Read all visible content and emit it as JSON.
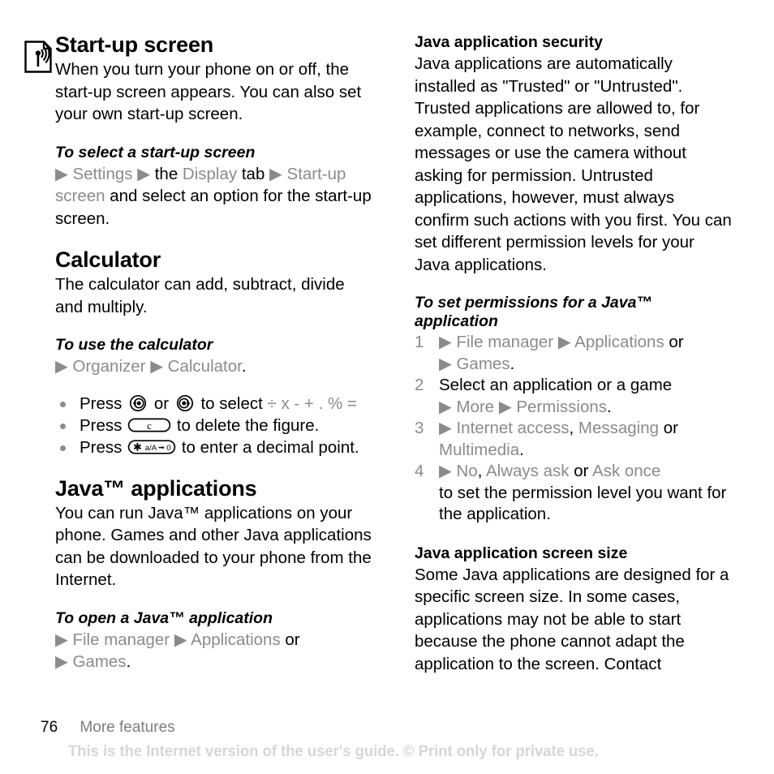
{
  "page": {
    "number": "76",
    "chapter": "More features",
    "disclaimer": "This is the Internet version of the user's guide. © Print only for private use."
  },
  "colors": {
    "text": "#000000",
    "ui_menu": "#8b8b8b",
    "disclaimer": "#d6d6d6",
    "chapter": "#7d7d7d"
  },
  "icons": {
    "margin": "broadcast-document-icon",
    "nav_left_key": "navigation-key-left",
    "nav_right_key": "navigation-key-right",
    "clear_key": "clear-key-c",
    "star_key": "star-key-a-A-0"
  },
  "left_column": {
    "startup": {
      "title": "Start-up screen",
      "body": "When you turn your phone on or off, the start-up screen appears. You can also set your own start-up screen.",
      "procedure": {
        "title": "To select a start-up screen",
        "parts": [
          {
            "type": "arrow",
            "text": "▶"
          },
          {
            "type": "ui",
            "text": "Settings"
          },
          {
            "type": "arrow",
            "text": "▶"
          },
          {
            "type": "text",
            "text": "the"
          },
          {
            "type": "ui",
            "text": "Display"
          },
          {
            "type": "text",
            "text": "tab"
          },
          {
            "type": "arrow",
            "text": "▶"
          },
          {
            "type": "ui",
            "text": "Start-up screen"
          },
          {
            "type": "text",
            "text": "and select an option for the start-up screen."
          }
        ]
      }
    },
    "calculator": {
      "title": "Calculator",
      "body": "The calculator can add, subtract, divide and multiply.",
      "procedure": {
        "title": "To use the calculator",
        "parts": [
          {
            "type": "arrow",
            "text": "▶"
          },
          {
            "type": "ui",
            "text": "Organizer"
          },
          {
            "type": "arrow",
            "text": "▶"
          },
          {
            "type": "ui",
            "text": "Calculator"
          },
          {
            "type": "text",
            "text": "."
          }
        ]
      },
      "bullets": [
        {
          "lead": "Press",
          "keys": [
            "navigation-key-left",
            "navigation-key-right"
          ],
          "between": "or",
          "tail": "to select",
          "symbols": "÷ x - + . % ="
        },
        {
          "lead": "Press",
          "keys": [
            "clear-key-c"
          ],
          "tail": "to delete the figure."
        },
        {
          "lead": "Press",
          "keys": [
            "star-key-a-A-0"
          ],
          "tail": "to enter a decimal point."
        }
      ]
    },
    "java_apps": {
      "title": "Java™ applications",
      "body": "You can run Java™ applications on your phone. Games and other Java applications can be downloaded to your phone from the Internet.",
      "procedure": {
        "title": "To open a Java™ application",
        "parts": [
          {
            "type": "arrow",
            "text": "▶"
          },
          {
            "type": "ui",
            "text": "File manager"
          },
          {
            "type": "arrow",
            "text": "▶"
          },
          {
            "type": "ui",
            "text": "Applications"
          },
          {
            "type": "text",
            "text": "or"
          },
          {
            "type": "break",
            "text": ""
          },
          {
            "type": "arrow",
            "text": "▶"
          },
          {
            "type": "ui",
            "text": "Games"
          },
          {
            "type": "text",
            "text": "."
          }
        ]
      }
    }
  },
  "right_column": {
    "security": {
      "title": "Java application security",
      "body": "Java applications are automatically installed as \"Trusted\" or \"Untrusted\". Trusted applications are allowed to, for example, connect to networks, send messages or use the camera without asking for permission. Untrusted applications, however, must always confirm such actions with you first. You can set different permission levels for your Java applications.",
      "procedure_title": "To set permissions for a Java™ application",
      "steps": [
        {
          "number": "1",
          "parts": [
            {
              "type": "arrow",
              "text": "▶"
            },
            {
              "type": "ui",
              "text": "File manager"
            },
            {
              "type": "arrow",
              "text": "▶"
            },
            {
              "type": "ui",
              "text": "Applications"
            },
            {
              "type": "text",
              "text": "or"
            },
            {
              "type": "break",
              "text": ""
            },
            {
              "type": "arrow",
              "text": "▶"
            },
            {
              "type": "ui",
              "text": "Games"
            },
            {
              "type": "text",
              "text": "."
            }
          ]
        },
        {
          "number": "2",
          "parts": [
            {
              "type": "text",
              "text": "Select an application or a game"
            },
            {
              "type": "break",
              "text": ""
            },
            {
              "type": "arrow",
              "text": "▶"
            },
            {
              "type": "ui",
              "text": "More"
            },
            {
              "type": "arrow",
              "text": "▶"
            },
            {
              "type": "ui",
              "text": "Permissions"
            },
            {
              "type": "text",
              "text": "."
            }
          ]
        },
        {
          "number": "3",
          "parts": [
            {
              "type": "arrow",
              "text": "▶"
            },
            {
              "type": "ui",
              "text": "Internet access"
            },
            {
              "type": "text",
              "text": ","
            },
            {
              "type": "ui",
              "text": "Messaging"
            },
            {
              "type": "text",
              "text": "or"
            },
            {
              "type": "break",
              "text": ""
            },
            {
              "type": "ui",
              "text": "Multimedia"
            },
            {
              "type": "text",
              "text": "."
            }
          ]
        },
        {
          "number": "4",
          "parts": [
            {
              "type": "arrow",
              "text": "▶"
            },
            {
              "type": "ui",
              "text": "No"
            },
            {
              "type": "text",
              "text": ","
            },
            {
              "type": "ui",
              "text": "Always ask"
            },
            {
              "type": "text",
              "text": "or"
            },
            {
              "type": "ui",
              "text": "Ask once"
            },
            {
              "type": "break",
              "text": ""
            },
            {
              "type": "text",
              "text": "to set the permission level you want for the application."
            }
          ]
        }
      ]
    },
    "screen_size": {
      "title": "Java application screen size",
      "body": "Some Java applications are designed for a specific screen size. In some cases, applications may not be able to start because the phone cannot adapt the application to the screen. Contact"
    }
  }
}
